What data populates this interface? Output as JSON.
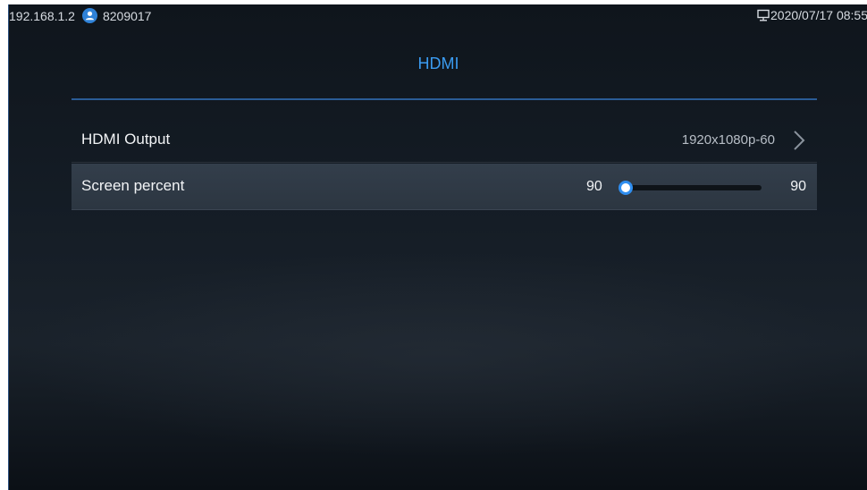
{
  "status_bar": {
    "ip_address": "192.168.1.2",
    "user_icon": "user-icon",
    "account_number": "8209017",
    "network_icon": "monitor-icon",
    "datetime": "2020/07/17 08:55"
  },
  "page": {
    "title": "HDMI"
  },
  "settings": {
    "hdmi_output": {
      "label": "HDMI Output",
      "value": "1920x1080p-60",
      "icon": "chevron-right-icon"
    },
    "screen_percent": {
      "label": "Screen percent",
      "min_label": "90",
      "max_label": "90",
      "level": 0.05
    }
  },
  "colors": {
    "accent": "#3a9bf0",
    "selected_row": "#2f3a46",
    "background": "#141c25"
  }
}
